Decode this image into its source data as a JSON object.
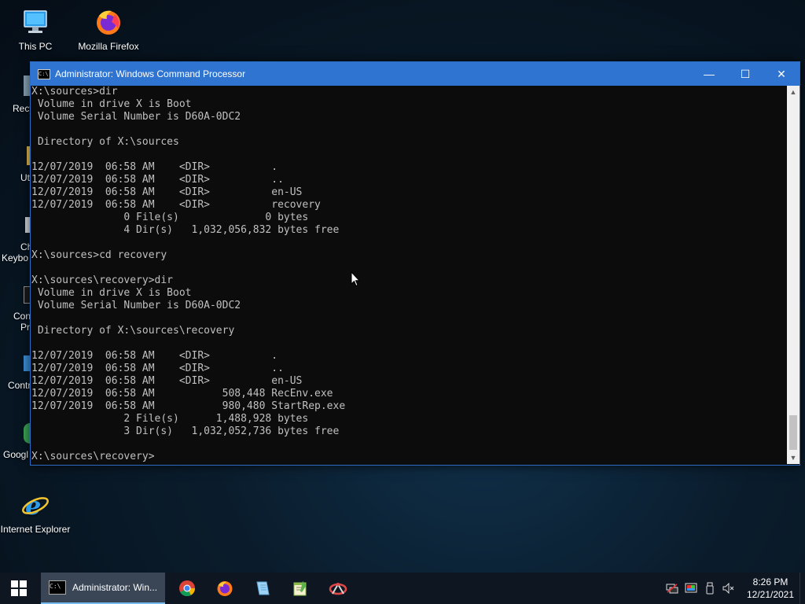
{
  "desktop": {
    "icons": [
      {
        "label": "This PC"
      },
      {
        "label": "Mozilla Firefox"
      },
      {
        "label": "Internet Explorer"
      }
    ],
    "partial_labels": [
      "Recy",
      "Ut",
      "Ch",
      "Keybo",
      "Con",
      "Pr",
      "Contr",
      "Googl"
    ]
  },
  "window": {
    "title": "Administrator: Windows Command Processor",
    "controls": {
      "minimize": "—",
      "maximize": "☐",
      "close": "✕"
    },
    "console_lines": [
      "X:\\sources>dir",
      " Volume in drive X is Boot",
      " Volume Serial Number is D60A-0DC2",
      "",
      " Directory of X:\\sources",
      "",
      "12/07/2019  06:58 AM    <DIR>          .",
      "12/07/2019  06:58 AM    <DIR>          ..",
      "12/07/2019  06:58 AM    <DIR>          en-US",
      "12/07/2019  06:58 AM    <DIR>          recovery",
      "               0 File(s)              0 bytes",
      "               4 Dir(s)   1,032,056,832 bytes free",
      "",
      "X:\\sources>cd recovery",
      "",
      "X:\\sources\\recovery>dir",
      " Volume in drive X is Boot",
      " Volume Serial Number is D60A-0DC2",
      "",
      " Directory of X:\\sources\\recovery",
      "",
      "12/07/2019  06:58 AM    <DIR>          .",
      "12/07/2019  06:58 AM    <DIR>          ..",
      "12/07/2019  06:58 AM    <DIR>          en-US",
      "12/07/2019  06:58 AM           508,448 RecEnv.exe",
      "12/07/2019  06:58 AM           980,480 StartRep.exe",
      "               2 File(s)      1,488,928 bytes",
      "               3 Dir(s)   1,032,052,736 bytes free",
      "",
      "X:\\sources\\recovery>"
    ]
  },
  "taskbar": {
    "active_task_label": "Administrator: Win...",
    "pinned": [
      "chrome-icon",
      "firefox-icon",
      "notepad-icon",
      "notepadpp-icon",
      "snipping-tool-icon"
    ],
    "clock": {
      "time": "8:26 PM",
      "date": "12/21/2021"
    }
  },
  "colors": {
    "titlebar": "#2f74d0",
    "console_bg": "#0c0c0c",
    "console_fg": "#c0c0c0",
    "taskbar": "#0e1622"
  }
}
